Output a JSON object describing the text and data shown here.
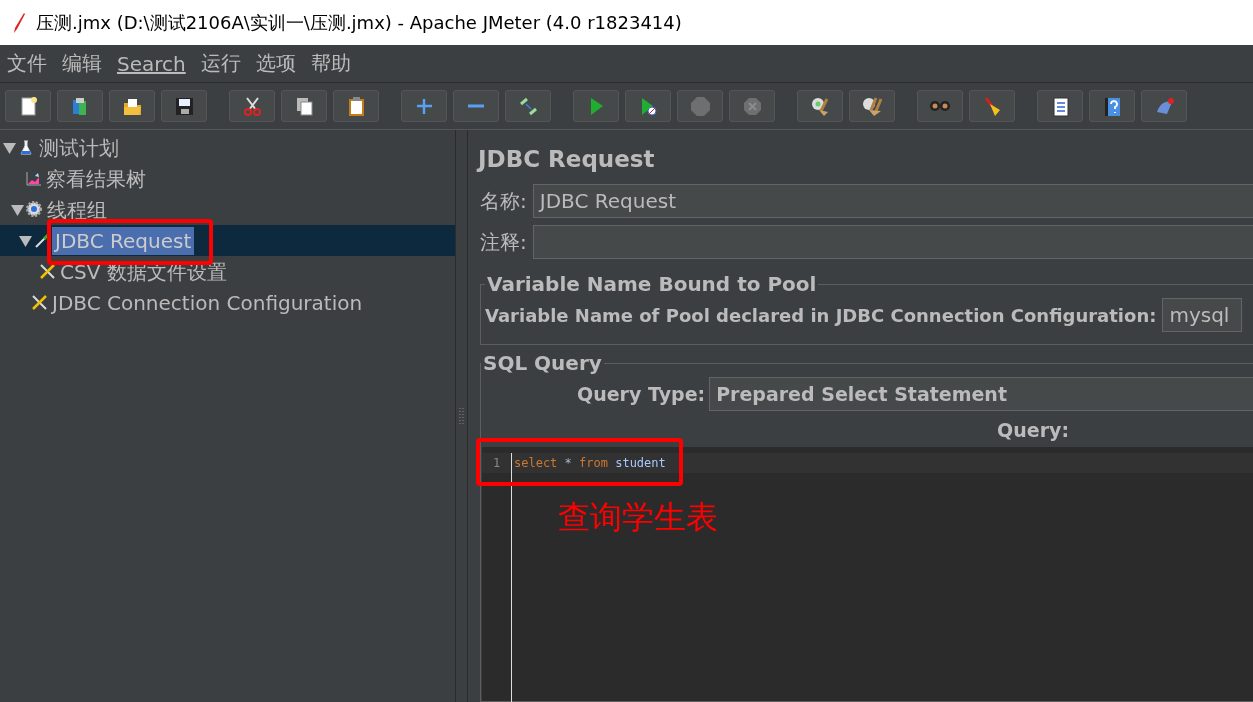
{
  "window": {
    "title": "压测.jmx (D:\\测试2106A\\实训一\\压测.jmx) - Apache JMeter (4.0 r1823414)"
  },
  "menu": [
    {
      "label": "文件",
      "underline": false
    },
    {
      "label": "编辑",
      "underline": false
    },
    {
      "label": "Search",
      "underline": true
    },
    {
      "label": "运行",
      "underline": false
    },
    {
      "label": "选项",
      "underline": false
    },
    {
      "label": "帮助",
      "underline": false
    }
  ],
  "toolbar": [
    [
      {
        "disabled": false
      },
      {
        "disabled": false
      },
      {
        "disabled": false
      },
      {
        "disabled": false
      }
    ],
    [
      {
        "disabled": false
      },
      {
        "disabled": false
      },
      {
        "disabled": false
      }
    ],
    [
      {
        "disabled": false
      },
      {
        "disabled": false
      },
      {
        "disabled": false
      }
    ],
    [
      {
        "disabled": false
      },
      {
        "disabled": false
      },
      {
        "disabled": true
      },
      {
        "disabled": true
      }
    ],
    [
      {
        "disabled": false
      },
      {
        "disabled": false
      }
    ],
    [
      {
        "disabled": false
      },
      {
        "disabled": false
      }
    ],
    [
      {
        "disabled": false
      },
      {
        "disabled": false
      },
      {
        "disabled": false
      }
    ]
  ],
  "tree": [
    {
      "label": "测试计划",
      "kind": "plan",
      "expanded": true,
      "selected": false,
      "children": [
        {
          "label": "察看结果树",
          "kind": "listener",
          "selected": false
        },
        {
          "label": "线程组",
          "kind": "threads",
          "expanded": true,
          "selected": false,
          "children": [
            {
              "label": "JDBC Request",
              "kind": "sampler",
              "expanded": true,
              "selected": true,
              "children": [
                {
                  "label": "CSV 数据文件设置",
                  "kind": "config",
                  "selected": false
                }
              ]
            },
            {
              "label": "JDBC Connection Configuration",
              "kind": "config",
              "selected": false
            }
          ]
        }
      ]
    }
  ],
  "panel": {
    "title": "JDBC Request",
    "name": {
      "label": "名称:",
      "value": "JDBC Request"
    },
    "comments": {
      "label": "注释:"
    },
    "pool_group": {
      "title": "Variable Name Bound to Pool",
      "label": "Variable Name of Pool declared in JDBC Connection Configuration:",
      "value": "mysql"
    },
    "sql_group": {
      "title": "SQL Query",
      "query_type_label": "Query Type:",
      "query_type": "Prepared Select Statement",
      "query_label": "Query:",
      "lines": [
        {
          "number": "1",
          "tokens": [
            {
              "text": "select",
              "kind": "keyword"
            },
            {
              "text": " * ",
              "kind": "plain"
            },
            {
              "text": "from",
              "kind": "keyword"
            },
            {
              "text": " student",
              "kind": "identifier"
            }
          ]
        }
      ]
    }
  },
  "annotation": {
    "text": "查询学生表"
  }
}
